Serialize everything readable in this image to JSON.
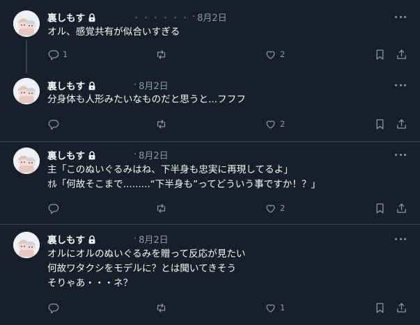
{
  "tweets": [
    {
      "user_name": "裏しもす",
      "handle": "・・・・・・",
      "date": "8月2日",
      "lines": [
        "オル、感覚共有が似合いすぎる"
      ],
      "reply_count": "1",
      "retweet_count": "",
      "like_count": "2"
    },
    {
      "user_name": "裏しもす",
      "handle": "",
      "date": "8月2日",
      "lines": [
        "分身体も人形みたいなものだと思うと...フフフ"
      ],
      "reply_count": "",
      "retweet_count": "",
      "like_count": "2"
    },
    {
      "user_name": "裏しもす",
      "handle": "",
      "date": "8月2日",
      "lines": [
        "主「このぬいぐるみはね、下半身も忠実に再現してるよ」",
        "ｵﾙ「何故そこまで.........“下半身も”ってどういう事ですか！？」"
      ],
      "reply_count": "",
      "retweet_count": "",
      "like_count": "2"
    },
    {
      "user_name": "裏しもす",
      "handle": "",
      "date": "8月2日",
      "lines": [
        "オルにオルのぬいぐるみを贈って反応が見たい",
        "何故ワタクシをモデルに？とは聞いてきそう",
        "そりゃあ・・・ネ？"
      ],
      "reply_count": "",
      "retweet_count": "",
      "like_count": "1"
    }
  ],
  "colors": {
    "background": "#15202b",
    "text": "#f7f9f9",
    "muted": "#8b98a5",
    "divider": "#38444d"
  },
  "icons": [
    "lock-icon",
    "more-icon",
    "reply-icon",
    "retweet-icon",
    "like-icon",
    "bookmark-icon",
    "share-icon"
  ]
}
